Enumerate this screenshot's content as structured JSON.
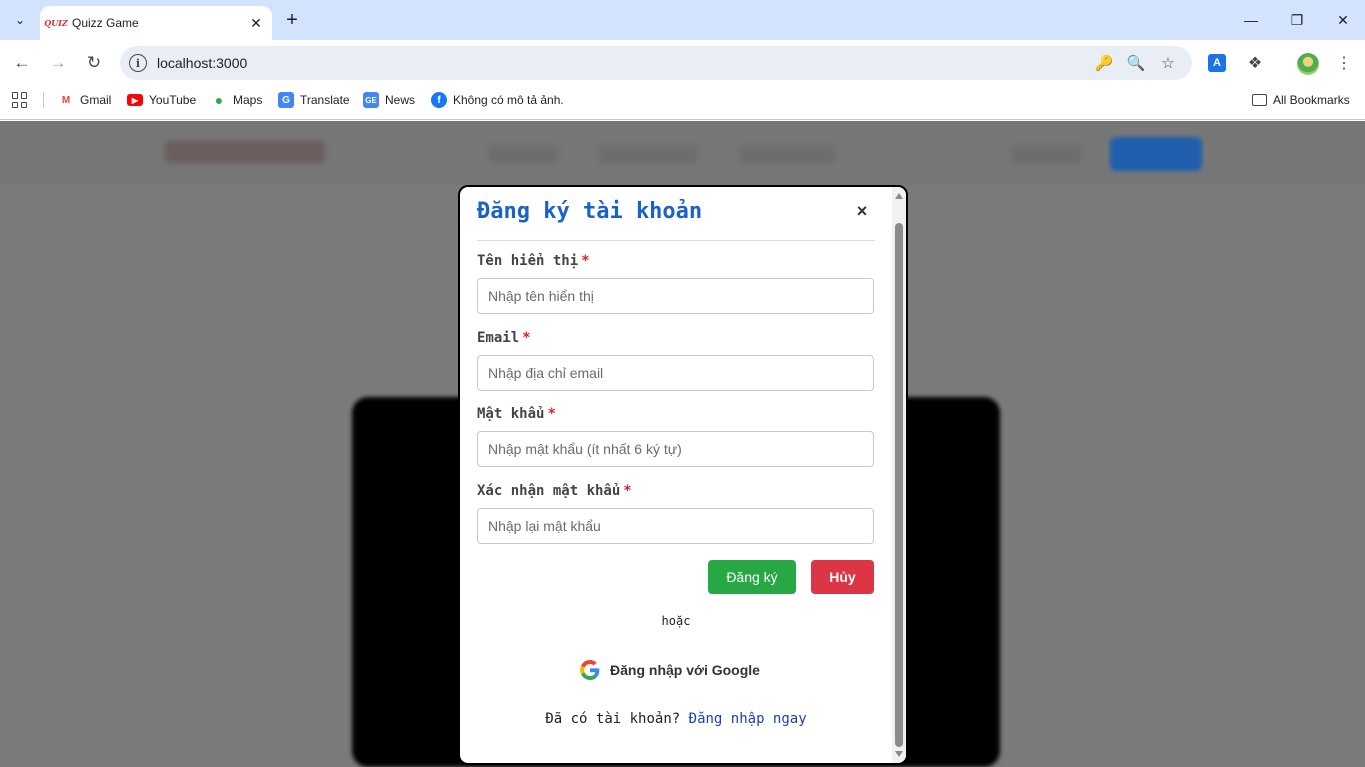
{
  "browser": {
    "tab_title": "Quizz Game",
    "tab_favicon_text": "QUIZ",
    "url": "localhost:3000",
    "bookmarks": [
      {
        "label": "Gmail",
        "icon": "gmail-icon"
      },
      {
        "label": "YouTube",
        "icon": "youtube-icon"
      },
      {
        "label": "Maps",
        "icon": "maps-icon"
      },
      {
        "label": "Translate",
        "icon": "translate-icon"
      },
      {
        "label": "News",
        "icon": "news-icon"
      },
      {
        "label": "Không có mô tả ảnh.",
        "icon": "facebook-icon"
      }
    ],
    "all_bookmarks": "All Bookmarks"
  },
  "modal": {
    "title": "Đăng ký tài khoản",
    "close": "×",
    "fields": [
      {
        "label": "Tên hiển thị",
        "required": "*",
        "placeholder": "Nhập tên hiển thị"
      },
      {
        "label": "Email",
        "required": "*",
        "placeholder": "Nhập địa chỉ email"
      },
      {
        "label": "Mật khẩu",
        "required": "*",
        "placeholder": "Nhập mật khẩu (ít nhất 6 ký tự)"
      },
      {
        "label": "Xác nhận mật khẩu",
        "required": "*",
        "placeholder": "Nhập lại mật khẩu"
      }
    ],
    "submit_label": "Đăng ký",
    "cancel_label": "Hủy",
    "or_text": "hoặc",
    "google_label": "Đăng nhập với Google",
    "footer_text": "Đã có tài khoản?",
    "login_link": "Đăng nhập ngay"
  },
  "colors": {
    "title_blue": "#1a62c8",
    "submit_green": "#28a745",
    "cancel_red": "#dc3545",
    "required_red": "#d9232e",
    "link_blue": "#1a3fb8"
  }
}
